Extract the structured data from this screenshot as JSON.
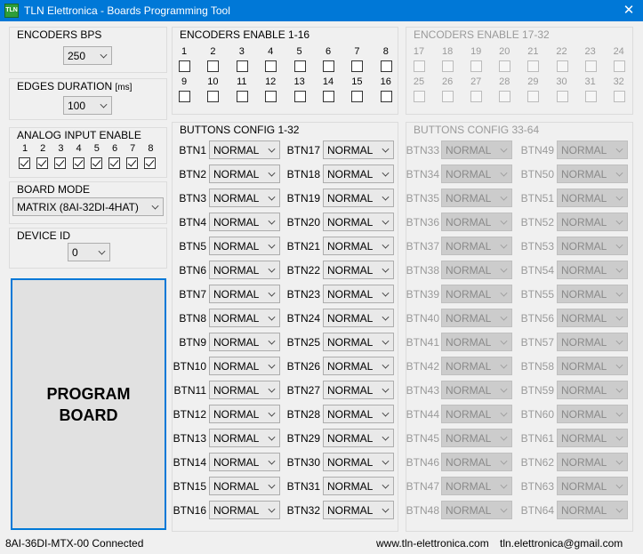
{
  "window": {
    "title": "TLN Elettronica - Boards Programming Tool",
    "close_glyph": "✕",
    "icon_text": "TLN"
  },
  "encoders_bps": {
    "label": "ENCODERS BPS",
    "value": "250"
  },
  "edges_duration": {
    "label": "EDGES DURATION",
    "unit": "[ms]",
    "value": "100"
  },
  "analog": {
    "label": "ANALOG INPUT ENABLE",
    "numbers": [
      "1",
      "2",
      "3",
      "4",
      "5",
      "6",
      "7",
      "8"
    ],
    "checked": [
      true,
      true,
      true,
      true,
      true,
      true,
      true,
      true
    ]
  },
  "board_mode": {
    "label": "BOARD MODE",
    "value": "MATRIX (8AI-32DI-4HAT)"
  },
  "device_id": {
    "label": "DEVICE ID",
    "value": "0"
  },
  "program_button": {
    "line1": "PROGRAM",
    "line2": "BOARD"
  },
  "enc1": {
    "label": "ENCODERS ENABLE 1-16",
    "numbers": [
      "1",
      "2",
      "3",
      "4",
      "5",
      "6",
      "7",
      "8",
      "9",
      "10",
      "11",
      "12",
      "13",
      "14",
      "15",
      "16"
    ]
  },
  "enc2": {
    "label": "ENCODERS ENABLE 17-32",
    "numbers": [
      "17",
      "18",
      "19",
      "20",
      "21",
      "22",
      "23",
      "24",
      "25",
      "26",
      "27",
      "28",
      "29",
      "30",
      "31",
      "32"
    ]
  },
  "buttons1": {
    "label": "BUTTONS CONFIG 1-32",
    "colA": [
      "BTN1",
      "BTN2",
      "BTN3",
      "BTN4",
      "BTN5",
      "BTN6",
      "BTN7",
      "BTN8",
      "BTN9",
      "BTN10",
      "BTN11",
      "BTN12",
      "BTN13",
      "BTN14",
      "BTN15",
      "BTN16"
    ],
    "colB": [
      "BTN17",
      "BTN18",
      "BTN19",
      "BTN20",
      "BTN21",
      "BTN22",
      "BTN23",
      "BTN24",
      "BTN25",
      "BTN26",
      "BTN27",
      "BTN28",
      "BTN29",
      "BTN30",
      "BTN31",
      "BTN32"
    ]
  },
  "buttons2": {
    "label": "BUTTONS CONFIG 33-64",
    "colA": [
      "BTN33",
      "BTN34",
      "BTN35",
      "BTN36",
      "BTN37",
      "BTN38",
      "BTN39",
      "BTN40",
      "BTN41",
      "BTN42",
      "BTN43",
      "BTN44",
      "BTN45",
      "BTN46",
      "BTN47",
      "BTN48"
    ],
    "colB": [
      "BTN49",
      "BTN50",
      "BTN51",
      "BTN52",
      "BTN53",
      "BTN54",
      "BTN55",
      "BTN56",
      "BTN57",
      "BTN58",
      "BTN59",
      "BTN60",
      "BTN61",
      "BTN62",
      "BTN63",
      "BTN64"
    ]
  },
  "button_mode_value": "NORMAL",
  "status": {
    "connection": "8AI-36DI-MTX-00 Connected",
    "website": "www.tln-elettronica.com",
    "email": "tln.elettronica@gmail.com"
  },
  "colors": {
    "titlebar": "#0078d7",
    "focus_border": "#0078d7",
    "disabled_text": "#9a9a9a"
  }
}
